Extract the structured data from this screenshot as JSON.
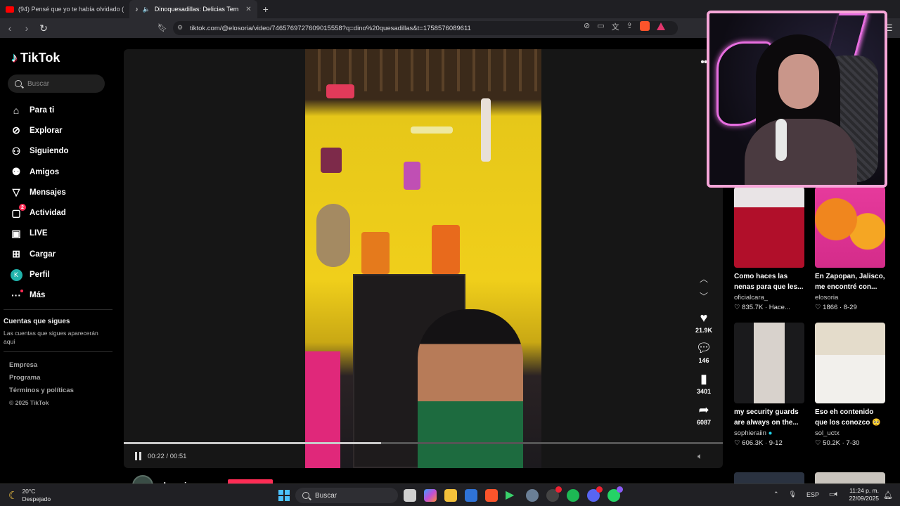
{
  "browser": {
    "tabs": [
      {
        "label": "(94) Pensé que yo te había olvidado ("
      },
      {
        "label": "Dinoquesadillas: Delicias Tem"
      }
    ],
    "new_tab": "+",
    "url": "tiktok.com/@elosoria/video/7465769727609015558?q=dino%20quesadillas&t=1758576089611",
    "icons": [
      "back-icon",
      "forward-icon",
      "reload-icon",
      "bookmark-icon",
      "site-info-icon",
      "translate-icon",
      "share-icon",
      "brave-shield-icon",
      "brave-rewards-icon",
      "menu-icon"
    ]
  },
  "sidebar": {
    "logo": "TikTok",
    "search_placeholder": "Buscar",
    "nav": [
      {
        "label": "Para ti",
        "icon": "home-icon"
      },
      {
        "label": "Explorar",
        "icon": "compass-icon"
      },
      {
        "label": "Siguiendo",
        "icon": "person-plus-icon"
      },
      {
        "label": "Amigos",
        "icon": "friends-icon"
      },
      {
        "label": "Mensajes",
        "icon": "send-icon"
      },
      {
        "label": "Actividad",
        "icon": "inbox-icon",
        "badge": "2"
      },
      {
        "label": "LIVE",
        "icon": "live-icon"
      },
      {
        "label": "Cargar",
        "icon": "upload-icon"
      },
      {
        "label": "Perfil",
        "icon": "avatar-icon",
        "avatar_letter": "K"
      },
      {
        "label": "Más",
        "icon": "more-icon"
      }
    ],
    "following_title": "Cuentas que sigues",
    "following_note": "Las cuentas que sigues aparecerán aquí",
    "footer": [
      "Empresa",
      "Programa",
      "Términos y políticas"
    ],
    "copyright": "© 2025 TikTok"
  },
  "player": {
    "time": "00:22 / 00:51",
    "progress": 0.43,
    "likes": "21.9K",
    "comments": "146",
    "saves": "3401",
    "shares": "6087",
    "author": "elosoria"
  },
  "recommendations": [
    {
      "title": "Como haces las nenas para que les...",
      "user": "oficialcara_",
      "meta": "♡ 835.7K · Hace..."
    },
    {
      "title": "En Zapopan, Jalisco, me encontré con...",
      "user": "elosoria",
      "meta": "♡ 1866 · 8-29"
    },
    {
      "title": "my security guards are always on the...",
      "user": "sophieraiin",
      "meta": "♡ 606.3K · 9-12"
    },
    {
      "title": "Eso eh contenido que los conozco 🥺",
      "user": "sol_uctx",
      "meta": "♡ 50.2K · 7-30"
    }
  ],
  "taskbar": {
    "temp": "20°C",
    "weather": "Despejado",
    "search": "Buscar",
    "lang": "ESP",
    "time": "11:24 p. m.",
    "date": "22/09/2025"
  },
  "colors": {
    "accent": "#fe2c55",
    "cam_border": "#f6a6d8"
  }
}
